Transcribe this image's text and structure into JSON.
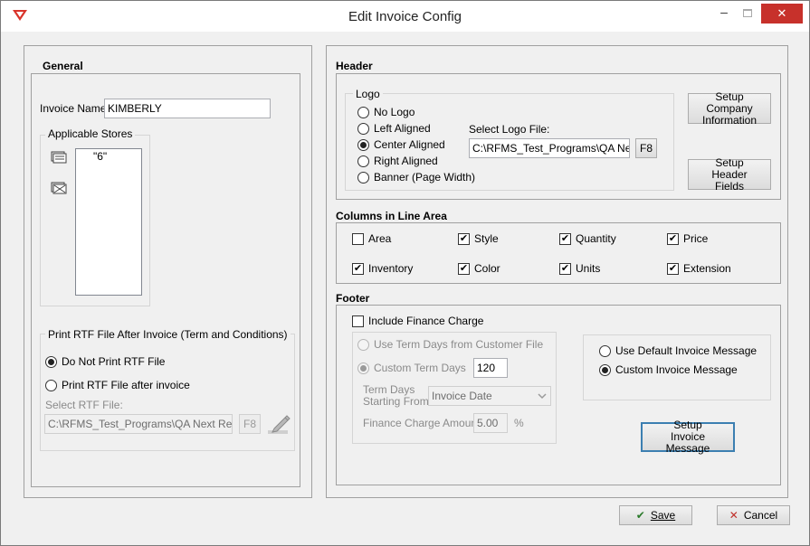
{
  "window": {
    "title": "Edit Invoice Config",
    "minimize": "–",
    "close": "✕"
  },
  "general": {
    "title": "General",
    "invoice_name_label": "Invoice Name:",
    "invoice_name_value": "KIMBERLY",
    "applicable_stores_label": "Applicable Stores",
    "stores": [
      "\"6\""
    ],
    "rtf_group_title": "Print RTF File After Invoice (Term and Conditions)",
    "rtf_options": [
      {
        "label": "Do Not Print RTF File",
        "selected": true
      },
      {
        "label": "Print RTF File after invoice",
        "selected": false
      }
    ],
    "select_rtf_label": "Select RTF File:",
    "rtf_file_value": "C:\\RFMS_Test_Programs\\QA Next Releas",
    "rtf_f8": "F8"
  },
  "header": {
    "title": "Header",
    "logo_group_title": "Logo",
    "logo_options": [
      {
        "label": "No Logo",
        "selected": false
      },
      {
        "label": "Left Aligned",
        "selected": false
      },
      {
        "label": "Center Aligned",
        "selected": true
      },
      {
        "label": "Right Aligned",
        "selected": false
      },
      {
        "label": "Banner (Page Width)",
        "selected": false
      }
    ],
    "select_logo_label": "Select Logo File:",
    "logo_file_value": "C:\\RFMS_Test_Programs\\QA Next",
    "logo_f8": "F8",
    "setup_company_button": "Setup Company Information",
    "setup_header_button": "Setup Header Fields"
  },
  "columns": {
    "title": "Columns in Line Area",
    "items": [
      {
        "label": "Area",
        "checked": false
      },
      {
        "label": "Style",
        "checked": true
      },
      {
        "label": "Quantity",
        "checked": true
      },
      {
        "label": "Price",
        "checked": true
      },
      {
        "label": "Inventory",
        "checked": true
      },
      {
        "label": "Color",
        "checked": true
      },
      {
        "label": "Units",
        "checked": true
      },
      {
        "label": "Extension",
        "checked": true
      }
    ]
  },
  "footer": {
    "title": "Footer",
    "include_finance_label": "Include Finance Charge",
    "include_finance_checked": false,
    "term_options": [
      {
        "label": "Use Term Days from Customer File",
        "selected": false
      },
      {
        "label": "Custom Term Days",
        "selected": true
      }
    ],
    "custom_term_days_value": "120",
    "term_days_starting_label_1": "Term Days",
    "term_days_starting_label_2": "Starting From:",
    "starting_from_value": "Invoice Date",
    "finance_amount_label": "Finance Charge Amount:",
    "finance_amount_value": "5.00",
    "percent_sign": "%",
    "message_options": [
      {
        "label": "Use Default Invoice Message",
        "selected": false
      },
      {
        "label": "Custom Invoice Message",
        "selected": true
      }
    ],
    "setup_invoice_message_button": "Setup Invoice Message"
  },
  "actions": {
    "save": "Save",
    "cancel": "Cancel"
  }
}
